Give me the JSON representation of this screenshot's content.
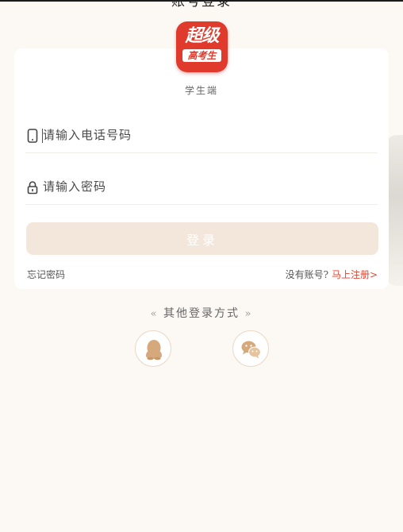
{
  "header": {
    "title": "账号登录"
  },
  "logo": {
    "line1": "超级",
    "line2": "高考生"
  },
  "subtitle": "学生端",
  "phone": {
    "placeholder": "请输入电话号码",
    "value": ""
  },
  "password": {
    "placeholder": "请输入密码",
    "value": ""
  },
  "login_button": "登录",
  "forgot_password": "忘记密码",
  "register": {
    "prompt": "没有账号?",
    "link": "马上注册>"
  },
  "other_login": {
    "label": "其他登录方式",
    "left_arrow": "«",
    "right_arrow": "»"
  },
  "social": [
    {
      "name": "qq-icon"
    },
    {
      "name": "wechat-icon"
    }
  ],
  "colors": {
    "background": "#fcf9f4",
    "brand_red": "#e03a2c",
    "button_disabled": "#f3e6db",
    "link_red": "#e4422f",
    "icon_gold": "#d6a97c"
  }
}
